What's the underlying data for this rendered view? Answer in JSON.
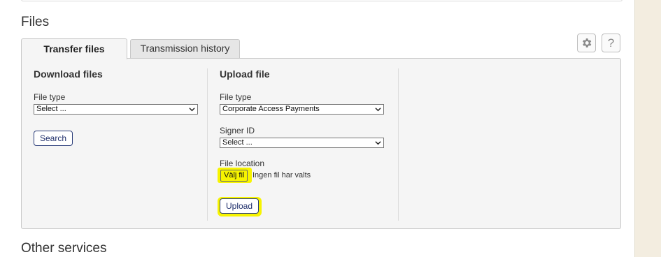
{
  "files_section": {
    "title": "Files"
  },
  "tabs": [
    {
      "label": "Transfer files",
      "active": true
    },
    {
      "label": "Transmission history",
      "active": false
    }
  ],
  "toolbar": {
    "settings_icon": "gear-icon",
    "help_icon": "?"
  },
  "download": {
    "title": "Download files",
    "file_type_label": "File type",
    "file_type_value": "Select ...",
    "search_label": "Search"
  },
  "upload": {
    "title": "Upload file",
    "file_type_label": "File type",
    "file_type_value": "Corporate Access Payments",
    "signer_label": "Signer ID",
    "signer_value": "Select ...",
    "file_location_label": "File location",
    "choose_file_label": "Välj fil",
    "no_file_text": "Ingen fil har valts",
    "upload_label": "Upload"
  },
  "other_section": {
    "title": "Other services"
  },
  "colors": {
    "highlight": "#f7f400",
    "button_border": "#2c3e7a",
    "background": "#f3ede0"
  }
}
